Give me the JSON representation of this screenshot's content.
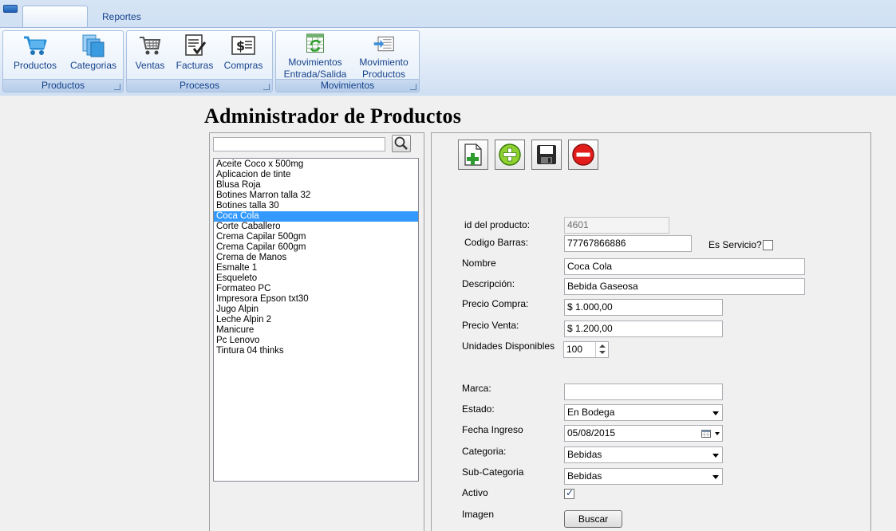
{
  "ribbon": {
    "tabs": [
      {
        "label": ""
      },
      {
        "label": "Reportes"
      }
    ],
    "groups": [
      {
        "label": "Productos",
        "buttons": [
          {
            "label": "Productos",
            "icon": "cart-icon"
          },
          {
            "label": "Categorias",
            "icon": "folders-icon"
          }
        ]
      },
      {
        "label": "Procesos",
        "buttons": [
          {
            "label": "Ventas",
            "icon": "shopping-cart-icon"
          },
          {
            "label": "Facturas",
            "icon": "invoice-check-icon"
          },
          {
            "label": "Compras",
            "icon": "dollar-document-icon"
          }
        ]
      },
      {
        "label": "Movimientos",
        "buttons": [
          {
            "label": "Movimientos Entrada/Salida",
            "line1": "Movimientos",
            "line2": "Entrada/Salida",
            "icon": "spreadsheet-refresh-icon"
          },
          {
            "label": "Movimiento Productos",
            "line1": "Movimiento",
            "line2": "Productos",
            "icon": "transfer-document-icon"
          }
        ]
      }
    ]
  },
  "page": {
    "title": "Administrador de Productos"
  },
  "search": {
    "value": "",
    "placeholder": ""
  },
  "products": [
    "Aceite Coco x 500mg",
    "Aplicacion de tinte",
    "Blusa Roja",
    "Botines Marron talla 32",
    "Botines talla 30",
    "Coca Cola",
    "Corte Caballero",
    "Crema Capilar 500gm",
    "Crema Capilar 600gm",
    "Crema de Manos",
    "Esmalte 1",
    "Esqueleto",
    "Formateo PC",
    "Impresora Epson txt30",
    "Jugo Alpin",
    "Leche Alpin 2",
    "Manicure",
    "Pc Lenovo",
    "Tintura 04 thinks"
  ],
  "selected_product": "Coca Cola",
  "toolbar": {
    "new": "new-document-icon",
    "add": "add-icon",
    "save": "save-icon",
    "delete": "delete-icon"
  },
  "form": {
    "id_label": "id del producto:",
    "id_value": "4601",
    "barcode_label": "Codigo Barras:",
    "barcode_value": "77767866886",
    "service_label": "Es Servicio?",
    "service_checked": false,
    "name_label": "Nombre",
    "name_value": "Coca Cola",
    "desc_label": "Descripción:",
    "desc_value": "Bebida Gaseosa",
    "buy_price_label": "Precio Compra:",
    "buy_price_value": "$ 1.000,00",
    "sell_price_label": "Precio Venta:",
    "sell_price_value": "$ 1.200,00",
    "units_label": "Unidades Disponibles",
    "units_value": "100",
    "brand_label": "Marca:",
    "brand_value": "",
    "state_label": "Estado:",
    "state_value": "En Bodega",
    "date_label": "Fecha Ingreso",
    "date_value": "05/08/2015",
    "category_label": "Categoria:",
    "category_value": "Bebidas",
    "subcategory_label": "Sub-Categoria",
    "subcategory_value": "Bebidas",
    "active_label": "Activo",
    "active_checked": true,
    "image_label": "Imagen",
    "browse_label": "Buscar"
  }
}
